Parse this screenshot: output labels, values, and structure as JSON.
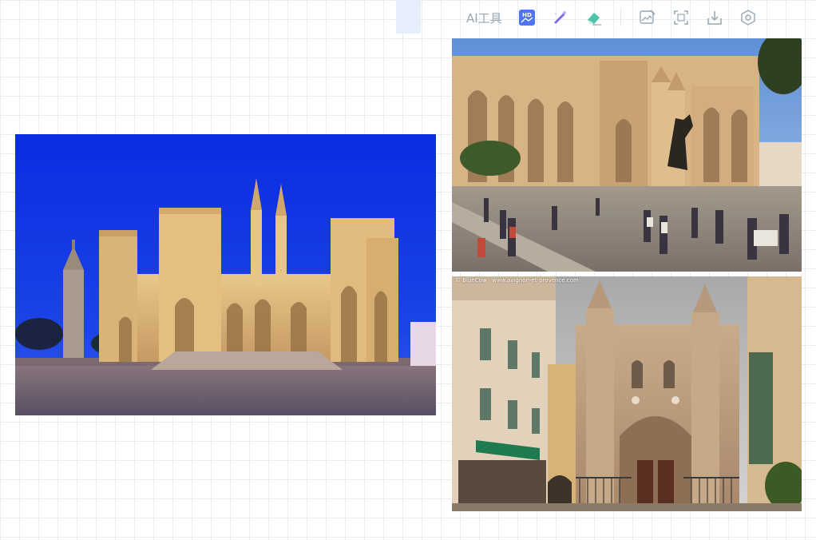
{
  "toolbar": {
    "ai_tools_label": "AI工具",
    "tools": [
      {
        "icon": "hd-icon",
        "accent": "#4f73f5"
      },
      {
        "icon": "magic-wand-icon",
        "accent": "#7c6cf0"
      },
      {
        "icon": "eraser-icon",
        "accent": "#4cc3a5"
      },
      {
        "icon": "image-edit-icon"
      },
      {
        "icon": "crop-icon"
      },
      {
        "icon": "download-icon"
      },
      {
        "icon": "settings-icon"
      }
    ]
  },
  "canvas": {
    "images": [
      {
        "name": "palais-des-papes-night",
        "watermark": ""
      },
      {
        "name": "palais-des-papes-square-day",
        "watermark": ""
      },
      {
        "name": "saint-pierre-church-facade",
        "watermark": "© BlueCow · www.avignon-et-provence.com"
      }
    ]
  },
  "colors": {
    "grid_line": "#e9eef3",
    "toolbar_icon": "#9aa5b1",
    "night_sky": "#1438d6"
  }
}
